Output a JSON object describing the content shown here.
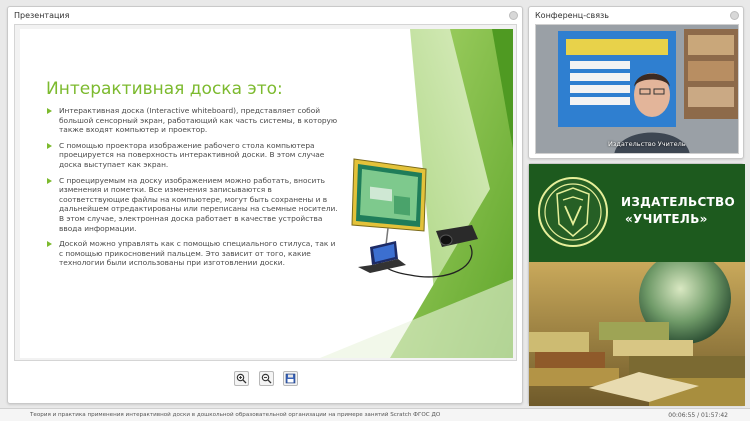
{
  "presentation": {
    "title": "Презентация",
    "slide": {
      "heading": "Интерактивная доска это:",
      "bullets": [
        "Интерактивная доска (Interactive whiteboard), представляет собой большой сенсорный экран, работающий как часть системы, в которую также входят компьютер и проектор.",
        "С помощью проектора изображение рабочего стола компьютера проецируется на поверхность интерактивной доски. В этом случае доска выступает как экран.",
        "С проецируемым на доску изображением можно работать, вносить изменения и пометки. Все изменения записываются в соответствующие файлы на компьютере, могут быть сохранены и в дальнейшем отредактированы или переписаны на съемные носители. В этом случае, электронная доска работает в качестве устройства ввода информации.",
        "Доской можно управлять как с помощью специального стилуса, так и с помощью прикосновений пальцем. Это зависит от того, какие технологии были использованы при изготовлении доски."
      ],
      "accent_color": "#7cba2e"
    },
    "toolbar": {
      "zoom_in_icon": "zoom-in-icon",
      "zoom_out_icon": "zoom-out-icon",
      "save_icon": "save-icon"
    }
  },
  "conference": {
    "title": "Конференц-связь",
    "speaker_name": "Издательство Учитель"
  },
  "publisher": {
    "name_line1": "ИЗДАТЕЛЬСТВО",
    "name_line2": "«УЧИТЕЛЬ»",
    "brand_color": "#1d5a1e"
  },
  "footer": {
    "webinar_title": "Теория и практика применения интерактивной доски в дошкольной образовательной организации на примере занятий Scratch ФГОС ДО",
    "time": "00:06:55 / 01:57:42"
  }
}
